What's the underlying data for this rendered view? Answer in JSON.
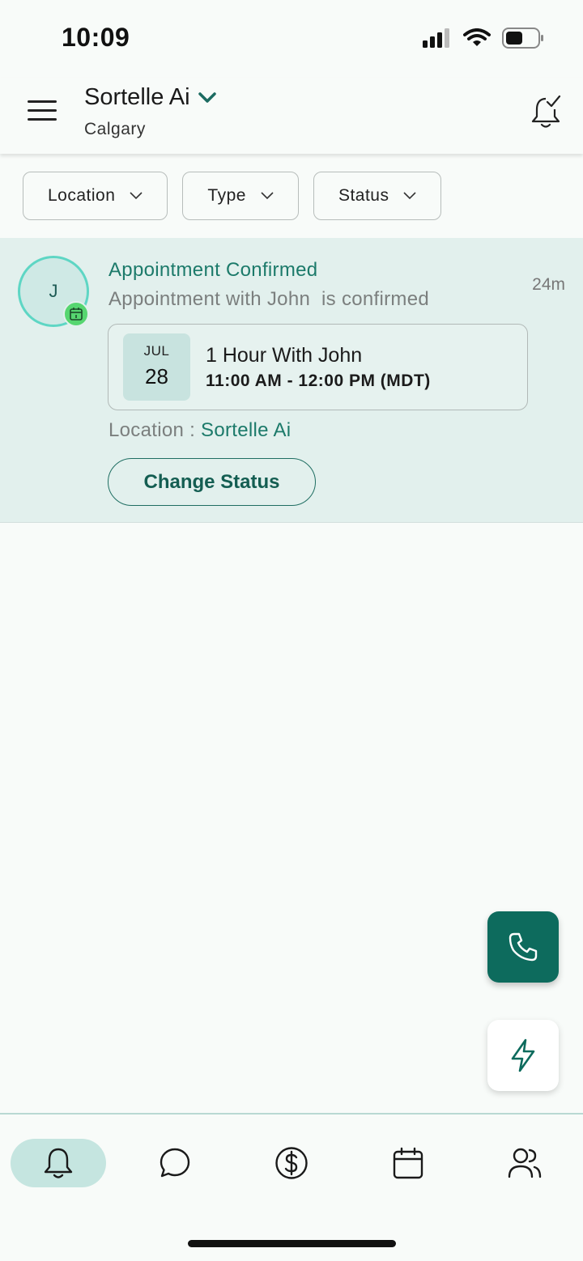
{
  "status_bar": {
    "time": "10:09"
  },
  "header": {
    "business_name": "Sortelle Ai",
    "location": "Calgary"
  },
  "filters": [
    {
      "label": "Location"
    },
    {
      "label": "Type"
    },
    {
      "label": "Status"
    }
  ],
  "notification": {
    "avatar_initial": "J",
    "title": "Appointment Confirmed",
    "description": "Appointment with John  is confirmed",
    "time_ago": "24m",
    "appointment": {
      "month": "JUL",
      "day": "28",
      "title": "1 Hour With John",
      "time_range": "11:00 AM - 12:00 PM (MDT)"
    },
    "location_label": "Location : ",
    "location_value": "Sortelle Ai",
    "action_label": "Change Status"
  },
  "bottom_nav": {
    "items": [
      {
        "icon": "bell-icon",
        "active": true
      },
      {
        "icon": "chat-icon",
        "active": false
      },
      {
        "icon": "dollar-icon",
        "active": false
      },
      {
        "icon": "calendar-icon",
        "active": false
      },
      {
        "icon": "contacts-icon",
        "active": false
      }
    ]
  },
  "colors": {
    "primary": "#0d6b5d",
    "accent_text": "#1c7a6a",
    "card_background": "#e2f0ed",
    "badge_green": "#56d670"
  }
}
